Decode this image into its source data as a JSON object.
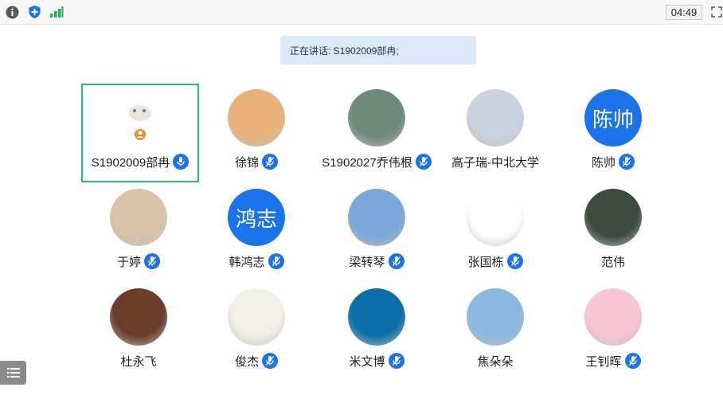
{
  "toolbar": {
    "info_icon": "info-icon",
    "shield_icon": "shield-plus-icon",
    "signal_icon": "signal-bars-icon",
    "timer": "04:49",
    "fullscreen_icon": "fullscreen-icon"
  },
  "speaking": {
    "label": "正在讲话: S1902009部冉;"
  },
  "colors": {
    "accent": "#1a73e8",
    "active_border": "#26c06a",
    "banner_bg": "#dbe9fb"
  },
  "participants": [
    {
      "name": "S1902009部冉",
      "avatar": "image",
      "mic": "on",
      "active": true
    },
    {
      "name": "徐锦",
      "avatar": "image",
      "mic": "muted"
    },
    {
      "name": "S1902027乔伟根",
      "avatar": "image",
      "mic": "muted"
    },
    {
      "name": "高子瑞-中北大学",
      "avatar": "image",
      "mic": "none"
    },
    {
      "name": "陈帅",
      "avatar": "text",
      "avatar_text": "陈帅",
      "mic": "muted"
    },
    {
      "name": "于婷",
      "avatar": "image",
      "mic": "muted"
    },
    {
      "name": "韩鸿志",
      "avatar": "text",
      "avatar_text": "鸿志",
      "mic": "muted"
    },
    {
      "name": "梁转琴",
      "avatar": "image",
      "mic": "muted"
    },
    {
      "name": "张国栋",
      "avatar": "image",
      "mic": "muted"
    },
    {
      "name": "范伟",
      "avatar": "image",
      "mic": "none"
    },
    {
      "name": "杜永飞",
      "avatar": "image",
      "mic": "none"
    },
    {
      "name": "俊杰",
      "avatar": "image",
      "mic": "muted"
    },
    {
      "name": "米文博",
      "avatar": "image",
      "mic": "muted"
    },
    {
      "name": "焦朵朵",
      "avatar": "image",
      "mic": "none"
    },
    {
      "name": "王钊晖",
      "avatar": "image",
      "mic": "muted"
    }
  ],
  "bottom": {
    "list_icon": "list-icon"
  }
}
